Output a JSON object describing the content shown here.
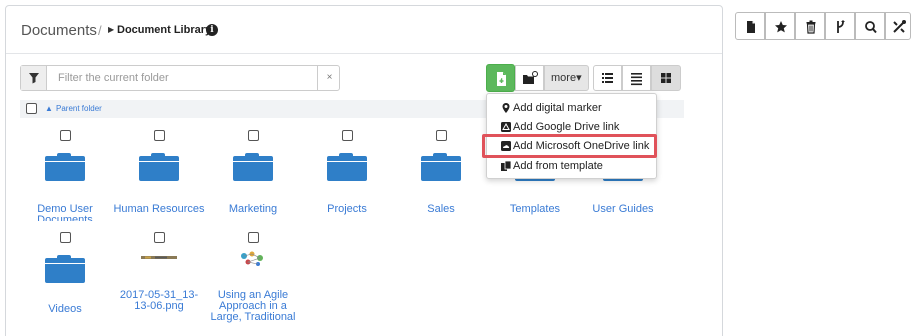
{
  "header": {
    "breadcrumb_root": "Documents",
    "breadcrumb_separator": "/",
    "breadcrumb_current": "Document Library",
    "info_glyph": "i"
  },
  "filter": {
    "placeholder": "Filter the current folder",
    "clear": "×"
  },
  "actions": {
    "more_label": "more",
    "more_caret": "▾"
  },
  "parent_folder": {
    "caret": "▲",
    "label": "Parent folder"
  },
  "items": [
    {
      "label_line1": "Demo User",
      "label_line2": "Documents",
      "kind": "folder"
    },
    {
      "label_line1": "Human Resources",
      "label_line2": "",
      "kind": "folder"
    },
    {
      "label_line1": "Marketing",
      "label_line2": "",
      "kind": "folder"
    },
    {
      "label_line1": "Projects",
      "label_line2": "",
      "kind": "folder"
    },
    {
      "label_line1": "Sales",
      "label_line2": "",
      "kind": "folder"
    },
    {
      "label_line1": "Templates",
      "label_line2": "",
      "kind": "folder"
    },
    {
      "label_line1": "User Guides",
      "label_line2": "",
      "kind": "folder"
    },
    {
      "label_line1": "Videos",
      "label_line2": "",
      "kind": "folder"
    },
    {
      "label_line1": "2017-05-31_13-",
      "label_line2": "13-06.png",
      "kind": "image"
    },
    {
      "label_line1": "Using an Agile",
      "label_line2": "Approach in a",
      "label_line3": "Large, Traditional",
      "kind": "document"
    }
  ],
  "more_menu": {
    "items": [
      {
        "label": "Add digital marker",
        "icon": "map-marker-icon"
      },
      {
        "label": "Add Google Drive link",
        "icon": "google-drive-icon"
      },
      {
        "label": "Add Microsoft OneDrive link",
        "icon": "onedrive-icon",
        "highlighted": true
      },
      {
        "label": "Add from template",
        "icon": "template-icon"
      }
    ]
  },
  "colors": {
    "link_blue": "#3a7bd5",
    "folder_blue": "#2f7fc8",
    "create_green": "#5cb85c",
    "highlight_red": "#e0525a"
  },
  "right_toolbar": {
    "icons": [
      "new-document-icon",
      "favorite-star-icon",
      "trash-icon",
      "fork-icon",
      "search-icon",
      "tools-icon"
    ]
  }
}
